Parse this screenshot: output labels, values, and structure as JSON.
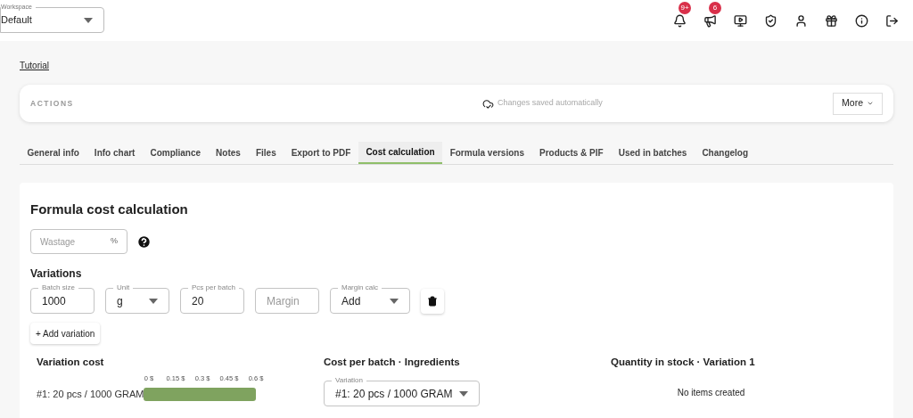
{
  "header": {
    "workspace": {
      "label": "Workspace",
      "value": "Default"
    },
    "icons": [
      {
        "kind": "bell",
        "badge": "9+"
      },
      {
        "kind": "megaphone",
        "badge": "6"
      },
      {
        "kind": "media"
      },
      {
        "kind": "shield"
      },
      {
        "kind": "user"
      },
      {
        "kind": "gift"
      },
      {
        "kind": "info"
      },
      {
        "kind": "logout"
      }
    ]
  },
  "tutorial_link": "Tutorial",
  "actions": {
    "title": "ACTIONS",
    "status": "Changes saved automatically",
    "more_button": "More"
  },
  "tabs": [
    {
      "label": "General info",
      "selected": false
    },
    {
      "label": "Info chart",
      "selected": false
    },
    {
      "label": "Compliance",
      "selected": false
    },
    {
      "label": "Notes",
      "selected": false
    },
    {
      "label": "Files",
      "selected": false
    },
    {
      "label": "Export to PDF",
      "selected": false
    },
    {
      "label": "Cost calculation",
      "selected": true
    },
    {
      "label": "Formula versions",
      "selected": false
    },
    {
      "label": "Products & PIF",
      "selected": false
    },
    {
      "label": "Used in batches",
      "selected": false
    },
    {
      "label": "Changelog",
      "selected": false
    }
  ],
  "section": {
    "title": "Formula cost calculation",
    "wastage": {
      "placeholder": "Wastage",
      "suffix": "%"
    },
    "variations_title": "Variations",
    "variations": [
      {
        "fields": [
          {
            "kind": "text",
            "label": "Batch size",
            "value": "1000"
          },
          {
            "kind": "select",
            "label": "Unit",
            "value": "g"
          },
          {
            "kind": "text",
            "label": "Pcs per batch",
            "value": "20"
          },
          {
            "kind": "text",
            "placeholder": "Margin"
          },
          {
            "kind": "select",
            "label": "Margin calc",
            "value": "Add"
          }
        ]
      }
    ],
    "add_button": "+ Add variation"
  },
  "variation_cost": {
    "title": "Variation cost",
    "chart_data": {
      "type": "bar",
      "orientation": "horizontal",
      "categories": [
        "#1: 20 pcs / 1000 GRAM"
      ],
      "values": [
        0.6
      ],
      "xlim": [
        0,
        0.6
      ],
      "xticks": [
        {
          "value": 0,
          "label": "0 $"
        },
        {
          "value": 0.15,
          "label": "0.15 $"
        },
        {
          "value": 0.3,
          "label": "0.3 $"
        },
        {
          "value": 0.45,
          "label": "0.45 $"
        },
        {
          "value": 0.6,
          "label": "0.6 $"
        }
      ]
    }
  },
  "cost_per_batch": {
    "title": "Cost per batch · Ingredients",
    "variation_select": {
      "label": "Variation",
      "value": "#1: 20 pcs / 1000 GRAM"
    }
  },
  "stock": {
    "title": "Quantity in stock · Variation 1",
    "empty_text": "No items created"
  }
}
